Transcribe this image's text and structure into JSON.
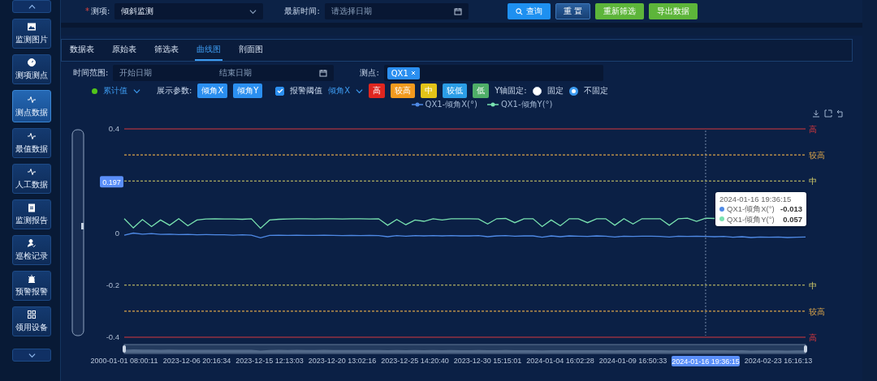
{
  "sidebar": {
    "items": [
      {
        "label": "监测图片",
        "selected": false
      },
      {
        "label": "测项测点",
        "selected": false
      },
      {
        "label": "测点数据",
        "selected": true
      },
      {
        "label": "最值数据",
        "selected": false
      },
      {
        "label": "人工数据",
        "selected": false
      },
      {
        "label": "监测报告",
        "selected": false
      },
      {
        "label": "巡检记录",
        "selected": false
      },
      {
        "label": "预警报警",
        "selected": false
      },
      {
        "label": "领用设备",
        "selected": false
      }
    ]
  },
  "filters": {
    "measure_item": {
      "required_mark": "*",
      "label": "测项:",
      "value": "倾斜监测"
    },
    "latest_time": {
      "label": "最新时间:",
      "placeholder": "请选择日期"
    }
  },
  "buttons": [
    {
      "label": "查询",
      "kind": "primary"
    },
    {
      "label": "重 置",
      "kind": "reset"
    },
    {
      "label": "重新筛选",
      "kind": "success"
    },
    {
      "label": "导出数据",
      "kind": "success"
    }
  ],
  "tabs": [
    {
      "label": "数据表",
      "selected": false
    },
    {
      "label": "原始表",
      "selected": false
    },
    {
      "label": "筛选表",
      "selected": false
    },
    {
      "label": "曲线图",
      "selected": true
    },
    {
      "label": "剖面图",
      "selected": false
    }
  ],
  "query": {
    "time_range": {
      "label": "时间范围:",
      "start_placeholder": "开始日期",
      "end_placeholder": "结束日期"
    },
    "point": {
      "label": "测点:",
      "tags": [
        "QX1"
      ]
    }
  },
  "params": {
    "value_type": {
      "value": "累计值"
    },
    "display_label": "展示参数:",
    "display_tags": [
      "倾角X",
      "倾角Y"
    ],
    "alarm": {
      "label": "报警阈值",
      "checked": true
    },
    "alarm_param": {
      "value": "倾角X"
    },
    "levels": [
      {
        "label": "高",
        "color": "#e0261f"
      },
      {
        "label": "较高",
        "color": "#f39a1e"
      },
      {
        "label": "中",
        "color": "#e2c318"
      },
      {
        "label": "较低",
        "color": "#2b9de6"
      },
      {
        "label": "低",
        "color": "#4fae68"
      }
    ],
    "y_axis": {
      "label": "Y轴固定:",
      "options": [
        {
          "label": "固定",
          "selected": false
        },
        {
          "label": "不固定",
          "selected": true
        }
      ]
    }
  },
  "chart": {
    "chart_data": {
      "type": "line",
      "ylim": [
        -0.4,
        0.4
      ],
      "yticks": [
        0.4,
        0,
        -0.2,
        -0.4
      ],
      "categories": [
        "2000-01-01 08:00:11",
        null,
        null,
        null,
        null,
        null,
        null,
        null,
        "2023-12-06 20:16:34",
        null,
        null,
        null,
        null,
        null,
        null,
        null,
        "2023-12-15 12:13:03",
        null,
        null,
        null,
        null,
        null,
        null,
        null,
        "2023-12-20 13:02:16",
        null,
        null,
        null,
        null,
        null,
        null,
        null,
        "2023-12-25 14:20:40",
        null,
        null,
        null,
        null,
        null,
        null,
        null,
        "2023-12-30 15:15:01",
        null,
        null,
        null,
        null,
        null,
        null,
        null,
        "2024-01-04 16:02:28",
        null,
        null,
        null,
        null,
        null,
        null,
        null,
        "2024-01-09 16:50:33",
        null,
        null,
        null,
        null,
        null,
        null,
        null,
        null,
        null,
        null,
        null,
        null,
        null,
        null,
        null,
        "2024-02-23 16:16:13",
        null,
        null,
        null
      ],
      "series": [
        {
          "name": "QX1-倾角X(°)",
          "color": "#4f8ae6",
          "values": [
            -0.008,
            0,
            -0.004,
            -0.002,
            -0.005,
            -0.004,
            -0.006,
            -0.005,
            -0.007,
            -0.006,
            -0.007,
            -0.007,
            -0.008,
            -0.007,
            -0.008,
            -0.018,
            -0.009,
            -0.008,
            -0.009,
            -0.008,
            -0.009,
            -0.009,
            -0.008,
            -0.009,
            -0.01,
            -0.009,
            -0.01,
            -0.009,
            -0.01,
            -0.014,
            -0.01,
            -0.012,
            -0.01,
            -0.011,
            -0.01,
            -0.011,
            -0.01,
            -0.011,
            -0.011,
            -0.01,
            -0.014,
            -0.011,
            -0.01,
            -0.012,
            -0.011,
            -0.011,
            -0.016,
            -0.011,
            -0.014,
            -0.011,
            -0.012,
            -0.013,
            -0.011,
            -0.012,
            -0.015,
            -0.012,
            -0.013,
            -0.012,
            -0.012,
            -0.013,
            -0.015,
            -0.012,
            -0.013,
            -0.012,
            -0.013,
            -0.014,
            -0.013,
            -0.016,
            -0.014,
            -0.017,
            -0.015,
            -0.016,
            -0.015,
            -0.017,
            -0.016,
            -0.015
          ]
        },
        {
          "name": "QX1-倾角Y(°)",
          "color": "#79e2b0",
          "values": [
            0.055,
            0.02,
            0.052,
            0.025,
            0.05,
            0.03,
            0.055,
            0.028,
            0.05,
            0.054,
            0.055,
            0.054,
            0.054,
            0.053,
            0.055,
            0.018,
            0.05,
            0.053,
            0.054,
            0.055,
            0.055,
            0.054,
            0.055,
            0.055,
            0.054,
            0.055,
            0.055,
            0.054,
            0.055,
            0.03,
            0.052,
            0.032,
            0.05,
            0.045,
            0.055,
            0.05,
            0.055,
            0.055,
            0.055,
            0.054,
            0.035,
            0.055,
            0.056,
            0.04,
            0.055,
            0.055,
            0.025,
            0.05,
            0.028,
            0.055,
            0.055,
            0.04,
            0.055,
            0.055,
            0.03,
            0.055,
            0.035,
            0.055,
            0.055,
            0.055,
            0.03,
            0.055,
            0.057,
            0.045,
            0.057,
            0.056,
            null,
            null,
            null,
            null,
            null,
            null,
            null,
            null,
            null,
            null
          ]
        }
      ],
      "ref_lines": [
        {
          "axis": "y",
          "label": "高",
          "value": 0.4,
          "color": "#d8383e"
        },
        {
          "axis": "y",
          "label": "较高",
          "value": 0.3,
          "color": "#d9a34a"
        },
        {
          "axis": "y",
          "label": "中",
          "value": 0.2,
          "color": "#d8d06a"
        },
        {
          "axis": "y",
          "label": "中",
          "value": -0.2,
          "color": "#d8d06a"
        },
        {
          "axis": "y",
          "label": "较高",
          "value": -0.3,
          "color": "#d9a34a"
        },
        {
          "axis": "y",
          "label": "高",
          "value": -0.4,
          "color": "#d8383e"
        }
      ],
      "annotations": [
        {
          "text": "0.197",
          "y": 0.197
        },
        "2024-01-16 19:36:15"
      ]
    },
    "tooltip": {
      "title": "2024-01-16 19:36:15",
      "rows": [
        {
          "name": "QX1-倾角X(°)",
          "value": "-0.013"
        },
        {
          "name": "QX1-倾角Y(°)",
          "value": "0.057"
        }
      ]
    }
  }
}
